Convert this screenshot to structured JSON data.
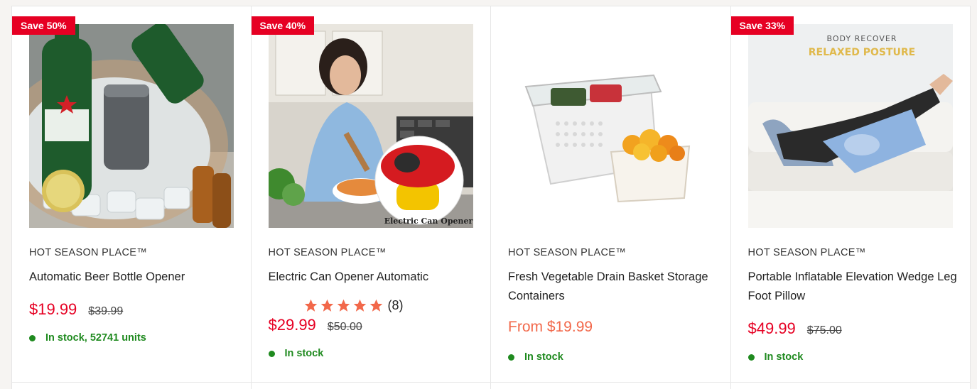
{
  "products": [
    {
      "badge": "Save 50%",
      "image": "beer-bottle-opener-photo",
      "vendor": "HOT SEASON PLACE™",
      "title": "Automatic Beer Bottle Opener",
      "price": "$19.99",
      "compare_price": "$39.99",
      "stock": "In stock, 52741 units"
    },
    {
      "badge": "Save 40%",
      "image": "electric-can-opener-photo",
      "image_caption": "Electric Can Opener",
      "vendor": "HOT SEASON PLACE™",
      "title": "Electric Can Opener Automatic",
      "rating": 5,
      "rating_count": "(8)",
      "price": "$29.99",
      "compare_price": "$50.00",
      "stock": "In stock"
    },
    {
      "image": "vegetable-drain-basket-photo",
      "vendor": "HOT SEASON PLACE™",
      "title": "Fresh Vegetable Drain Basket Storage Containers",
      "price_from": "From $19.99",
      "stock": "In stock"
    },
    {
      "badge": "Save 33%",
      "image": "inflatable-leg-pillow-photo",
      "image_text_1": "BODY RECOVER",
      "image_text_2": "RELAXED POSTURE",
      "vendor": "HOT SEASON PLACE™",
      "title": "Portable Inflatable Elevation Wedge Leg Foot Pillow",
      "price": "$49.99",
      "compare_price": "$75.00",
      "stock": "In stock"
    }
  ],
  "colors": {
    "badge": "#e60023",
    "price": "#e60023",
    "from_price": "#f2684a",
    "in_stock": "#1f8a1f",
    "star": "#f2684a"
  }
}
